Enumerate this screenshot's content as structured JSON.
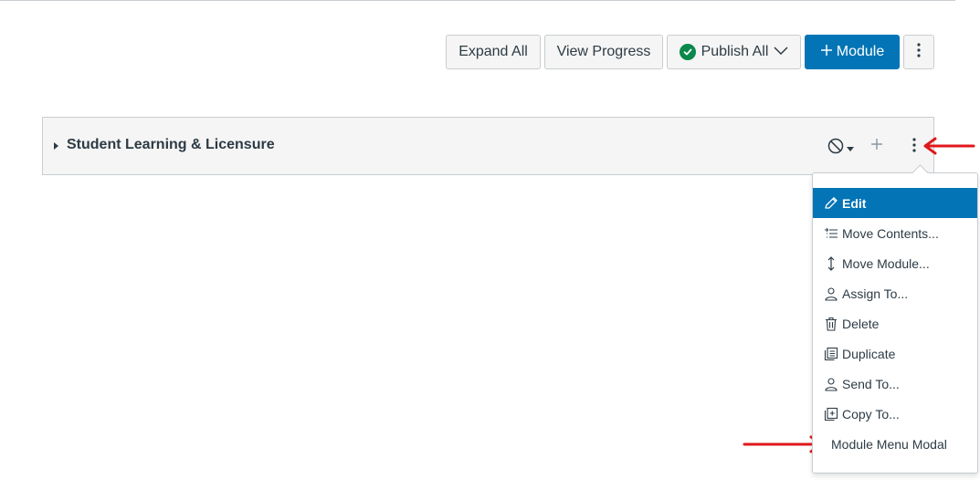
{
  "toolbar": {
    "expand_all": "Expand All",
    "view_progress": "View Progress",
    "publish_all": "Publish All",
    "add_module": "Module"
  },
  "module": {
    "title": "Student Learning & Licensure"
  },
  "menu": {
    "items": [
      {
        "label": "Edit",
        "icon": "pencil-icon",
        "active": true
      },
      {
        "label": "Move Contents...",
        "icon": "move-contents-icon"
      },
      {
        "label": "Move Module...",
        "icon": "move-vertical-icon"
      },
      {
        "label": "Assign To...",
        "icon": "user-icon"
      },
      {
        "label": "Delete",
        "icon": "trash-icon"
      },
      {
        "label": "Duplicate",
        "icon": "duplicate-icon"
      },
      {
        "label": "Send To...",
        "icon": "user-icon"
      },
      {
        "label": "Copy To...",
        "icon": "copy-icon"
      },
      {
        "label": "Module Menu Modal",
        "icon": ""
      }
    ]
  },
  "colors": {
    "accent": "#0374b5",
    "success": "#0b874b",
    "annotation_arrow": "#e0191b"
  }
}
